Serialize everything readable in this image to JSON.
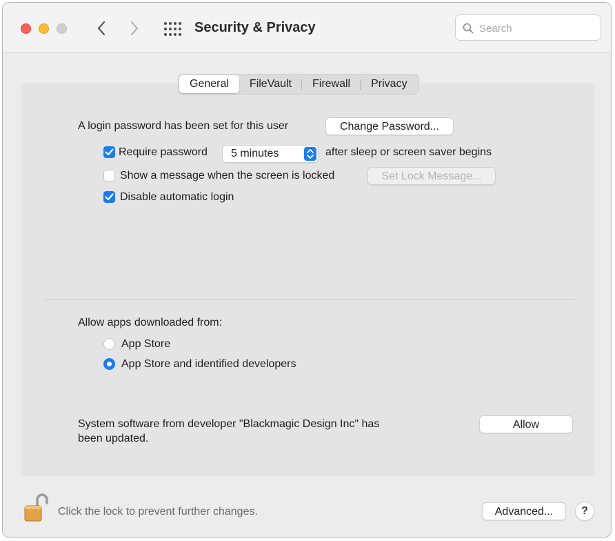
{
  "window": {
    "title": "Security & Privacy",
    "search_placeholder": "Search"
  },
  "tabs": [
    {
      "label": "General",
      "active": true
    },
    {
      "label": "FileVault",
      "active": false
    },
    {
      "label": "Firewall",
      "active": false
    },
    {
      "label": "Privacy",
      "active": false
    }
  ],
  "general": {
    "login_password_text": "A login password has been set for this user",
    "change_password_label": "Change Password...",
    "require_password": {
      "label": "Require password",
      "checked": true,
      "interval": "5 minutes",
      "suffix": "after sleep or screen saver begins"
    },
    "show_message": {
      "label": "Show a message when the screen is locked",
      "checked": false,
      "button_label": "Set Lock Message..."
    },
    "disable_auto_login": {
      "label": "Disable automatic login",
      "checked": true
    },
    "allow_apps_heading": "Allow apps downloaded from:",
    "allow_options": [
      {
        "label": "App Store",
        "selected": false
      },
      {
        "label": "App Store and identified developers",
        "selected": true
      }
    ],
    "system_software_line1": "System software from developer \"Blackmagic Design Inc\" has",
    "system_software_line2": "been updated.",
    "allow_button_label": "Allow"
  },
  "footer": {
    "lock_text": "Click the lock to prevent further changes.",
    "advanced_label": "Advanced...",
    "help_label": "?"
  },
  "colors": {
    "accent": "#1a7cf5",
    "close": "#fe5f57",
    "minimize": "#febc2e"
  }
}
